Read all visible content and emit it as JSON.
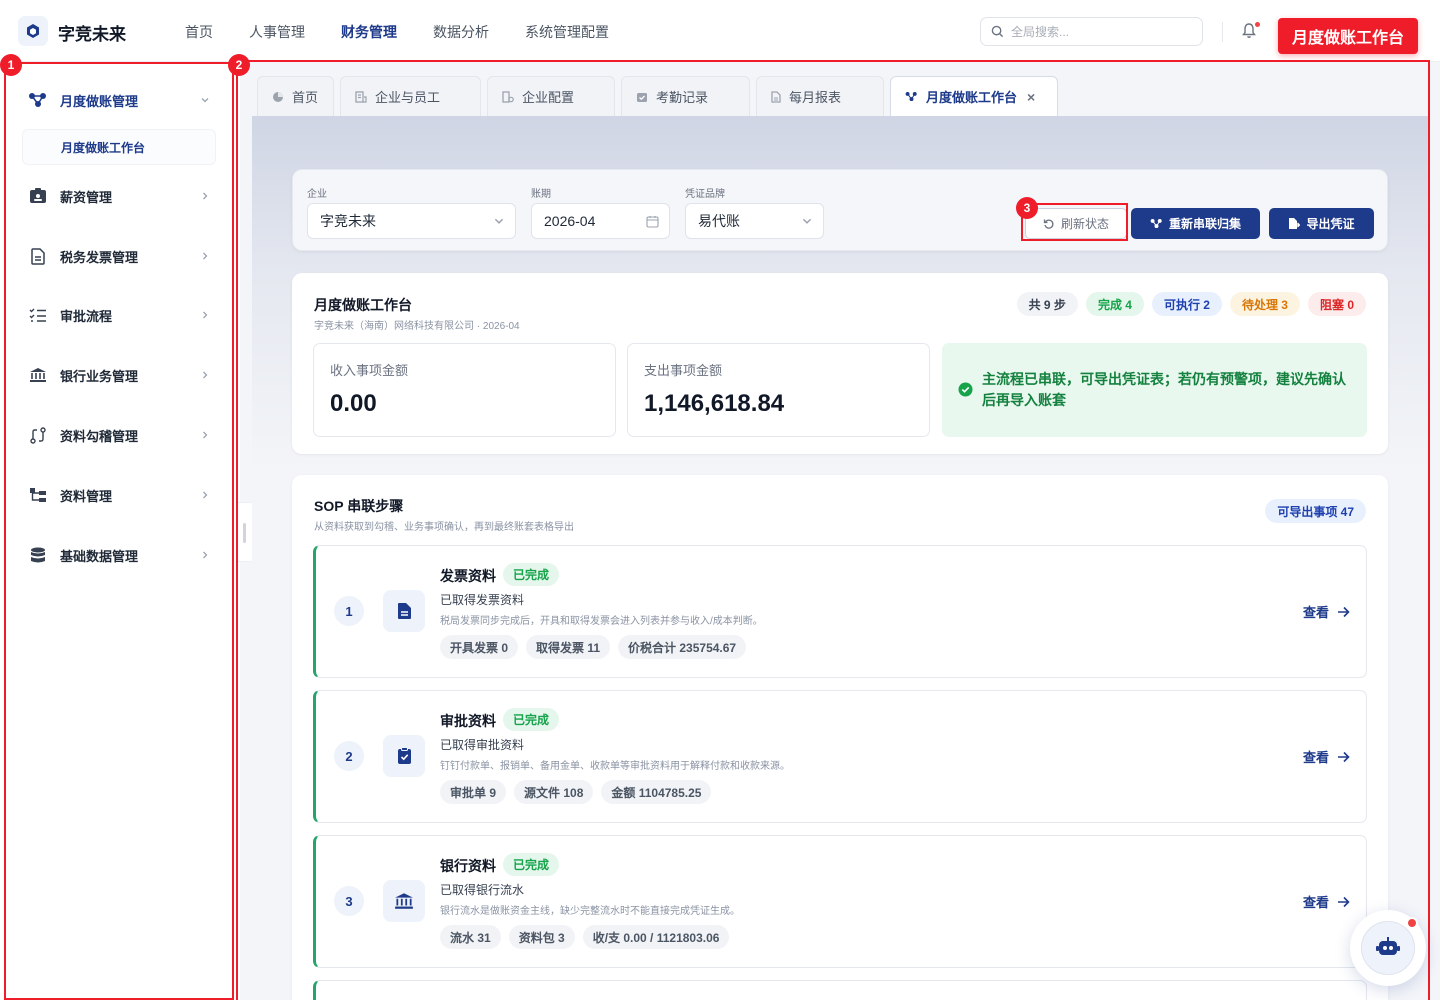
{
  "app": {
    "name": "字竞未来",
    "logo_icon": "hexagon-logo-icon"
  },
  "topnav": [
    {
      "label": "首页",
      "active": false
    },
    {
      "label": "人事管理",
      "active": false
    },
    {
      "label": "财务管理",
      "active": true
    },
    {
      "label": "数据分析",
      "active": false
    },
    {
      "label": "系统管理配置",
      "active": false
    }
  ],
  "search": {
    "placeholder": "全局搜索..."
  },
  "header_tag": "月度做账工作台",
  "sidebar": {
    "groups": [
      {
        "label": "月度做账管理",
        "icon": "workflow-icon",
        "expanded": true
      },
      {
        "label": "薪资管理",
        "icon": "id-card-icon"
      },
      {
        "label": "税务发票管理",
        "icon": "document-icon"
      },
      {
        "label": "审批流程",
        "icon": "checklist-icon"
      },
      {
        "label": "银行业务管理",
        "icon": "bank-icon"
      },
      {
        "label": "资料勾稽管理",
        "icon": "route-icon"
      },
      {
        "label": "资料管理",
        "icon": "tree-icon"
      },
      {
        "label": "基础数据管理",
        "icon": "database-icon"
      }
    ],
    "sub_item": "月度做账工作台"
  },
  "tabs": [
    {
      "label": "首页",
      "icon": "pie-icon"
    },
    {
      "label": "企业与员工",
      "icon": "building-icon"
    },
    {
      "label": "企业配置",
      "icon": "gear-building-icon"
    },
    {
      "label": "考勤记录",
      "icon": "calendar-check-icon"
    },
    {
      "label": "每月报表",
      "icon": "file-icon"
    },
    {
      "label": "月度做账工作台",
      "icon": "workflow-icon",
      "active": true,
      "close": "×"
    }
  ],
  "filters": {
    "company_label": "企业",
    "company_value": "字竞未来",
    "period_label": "账期",
    "period_value": "2026-04",
    "brand_label": "凭证品牌",
    "brand_value": "易代账",
    "refresh_label": "刷新状态",
    "relink_label": "重新串联归集",
    "export_label": "导出凭证"
  },
  "summary": {
    "title": "月度做账工作台",
    "subtitle": "字竞未来（海南）网络科技有限公司 · 2026-04",
    "badges": [
      {
        "label": "共 9 步",
        "bg": "#f1f3f6",
        "fg": "#374151"
      },
      {
        "label": "完成 4",
        "bg": "#e5f6ec",
        "fg": "#16a34a"
      },
      {
        "label": "可执行 2",
        "bg": "#e8f0fe",
        "fg": "#1e40af"
      },
      {
        "label": "待处理 3",
        "bg": "#fdf3e1",
        "fg": "#d97706"
      },
      {
        "label": "阻塞 0",
        "bg": "#fdecec",
        "fg": "#dc2626"
      }
    ],
    "income_label": "收入事项金额",
    "income_value": "0.00",
    "expense_label": "支出事项金额",
    "expense_value": "1,146,618.84",
    "notice": "主流程已串联，可导出凭证表；若仍有预警项，建议先确认后再导入账套"
  },
  "sop": {
    "title": "SOP 串联步骤",
    "subtitle": "从资料获取到勾稽、业务事项确认，再到最终账套表格导出",
    "export_badge": "可导出事项 47",
    "view_label": "查看",
    "steps": [
      {
        "num": "1",
        "icon": "invoice-icon",
        "title": "发票资料",
        "status": "已完成",
        "desc": "已取得发票资料",
        "note": "税局发票同步完成后，开具和取得发票会进入列表并参与收入/成本判断。",
        "chips": [
          "开具发票 0",
          "取得发票 11",
          "价税合计 235754.67"
        ]
      },
      {
        "num": "2",
        "icon": "clipboard-check-icon",
        "title": "审批资料",
        "status": "已完成",
        "desc": "已取得审批资料",
        "note": "钉钉付款单、报销单、备用金单、收款单等审批资料用于解释付款和收款来源。",
        "chips": [
          "审批单 9",
          "源文件 108",
          "金额 1104785.25"
        ]
      },
      {
        "num": "3",
        "icon": "bank-icon",
        "title": "银行资料",
        "status": "已完成",
        "desc": "已取得银行流水",
        "note": "银行流水是做账资金主线，缺少完整流水时不能直接完成凭证生成。",
        "chips": [
          "流水 31",
          "资料包 3",
          "收/支 0.00 / 1121803.06"
        ]
      }
    ]
  },
  "annotations": [
    "1",
    "2",
    "3"
  ],
  "colors": {
    "primary": "#1e3a8a",
    "annotation": "#ef1c2a",
    "success": "#27a46b"
  }
}
